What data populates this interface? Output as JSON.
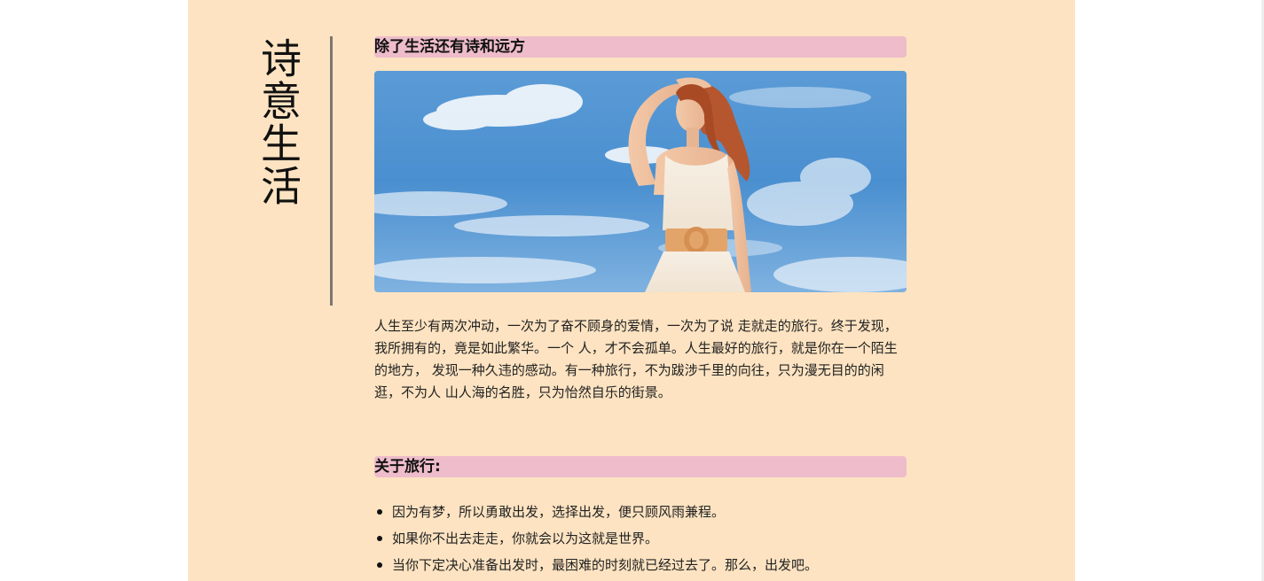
{
  "page": {
    "vertical_title": "诗意生活",
    "section1": {
      "heading": "除了生活还有诗和远方",
      "image_alt": "woman in white dress shading eyes against blue sky",
      "paragraph": "人生至少有两次冲动，一次为了奋不顾身的爱情，一次为了说 走就走的旅行。终于发现，我所拥有的，竟是如此繁华。一个 人，才不会孤单。人生最好的旅行，就是你在一个陌生的地方， 发现一种久违的感动。有一种旅行，不为跋涉千里的向往，只为漫无目的的闲逛，不为人 山人海的名胜，只为怡然自乐的街景。"
    },
    "section2": {
      "heading": "关于旅行:",
      "items": [
        "因为有梦，所以勇敢出发，选择出发，便只顾风雨兼程。",
        "如果你不出去走走，你就会以为这就是世界。",
        "当你下定决心准备出发时，最困难的时刻就已经过去了。那么，出发吧。"
      ]
    }
  },
  "colors": {
    "page_background": "#fde3c1",
    "heading_bar": "#eebccb",
    "rule": "#7d7672",
    "sky": "#4a8fd0"
  }
}
